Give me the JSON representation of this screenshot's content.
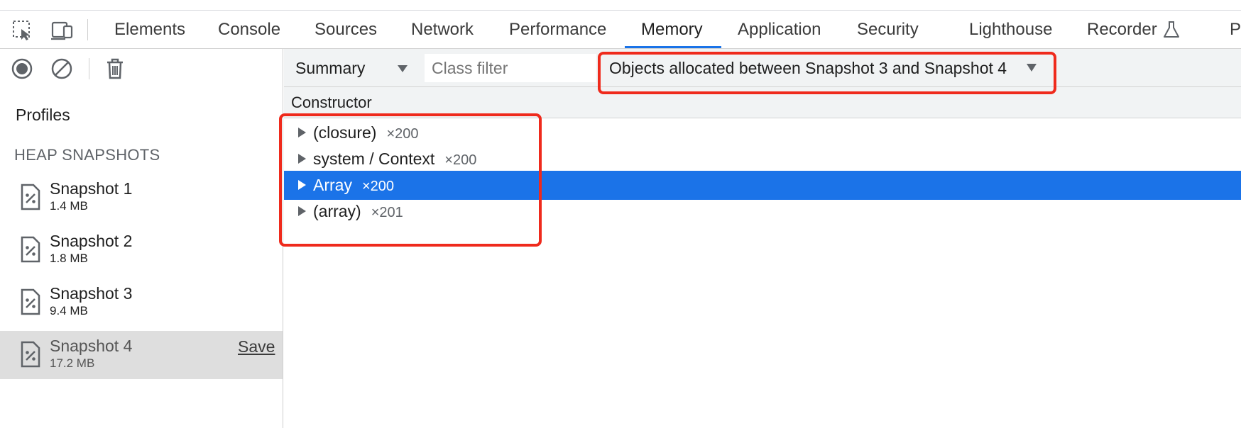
{
  "tabs": [
    {
      "label": "Elements"
    },
    {
      "label": "Console"
    },
    {
      "label": "Sources"
    },
    {
      "label": "Network"
    },
    {
      "label": "Performance"
    },
    {
      "label": "Memory",
      "active": true
    },
    {
      "label": "Application"
    },
    {
      "label": "Security"
    },
    {
      "label": "Lighthouse"
    },
    {
      "label": "Recorder"
    },
    {
      "label": "P"
    }
  ],
  "toolbar_icons": [
    "inspect-element-icon",
    "device-toolbar-icon",
    "flask-icon"
  ],
  "sidebar": {
    "toolbar_icons": [
      "record-icon",
      "clear-icon",
      "trash-icon"
    ],
    "profiles_label": "Profiles",
    "section_label": "HEAP SNAPSHOTS",
    "snapshots": [
      {
        "name": "Snapshot 1",
        "size": "1.4 MB"
      },
      {
        "name": "Snapshot 2",
        "size": "1.8 MB"
      },
      {
        "name": "Snapshot 3",
        "size": "9.4 MB"
      },
      {
        "name": "Snapshot 4",
        "size": "17.2 MB",
        "selected": true,
        "action": "Save"
      }
    ]
  },
  "main": {
    "view": "Summary",
    "class_filter_placeholder": "Class filter",
    "range": "Objects allocated between Snapshot 3 and Snapshot 4",
    "column_header": "Constructor",
    "rows": [
      {
        "name": "(closure)",
        "count": "×200"
      },
      {
        "name": "system / Context",
        "count": "×200"
      },
      {
        "name": "Array",
        "count": "×200",
        "selected": true
      },
      {
        "name": "(array)",
        "count": "×201"
      }
    ]
  },
  "colors": {
    "accent": "#1a73e8",
    "selection": "#1b73e8",
    "annotation": "#ef2a1c"
  }
}
